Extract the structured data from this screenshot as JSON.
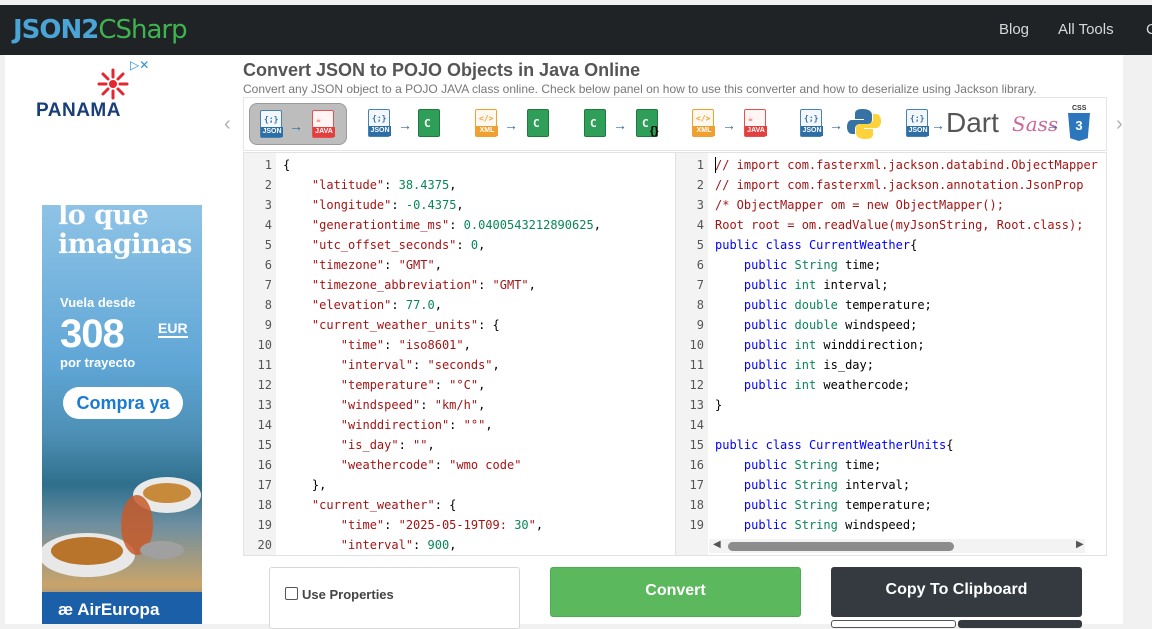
{
  "nav": {
    "logo_part1": "JSON2",
    "logo_part2": "CSharp",
    "links": [
      "Blog",
      "All Tools",
      "C"
    ]
  },
  "ad": {
    "brand": "PANAMA",
    "headline": "Más de lo que imaginas",
    "vuela": "Vuela desde",
    "price": "308",
    "currency": "EUR",
    "per": "por trayecto",
    "cta": "Compra ya",
    "airline": "AirEuropa",
    "choices_icon": "ad-choices-icon"
  },
  "page": {
    "title": "Convert JSON to POJO Objects in Java Online",
    "subtitle": "Convert any JSON object to a POJO JAVA class online. Check below panel on how to use this converter and how to deserialize using Jackson library."
  },
  "converters": [
    {
      "name": "json-to-java",
      "from": "JSON",
      "to": "JAVA",
      "active": true
    },
    {
      "name": "json-to-csharp",
      "from": "JSON",
      "to": "C#"
    },
    {
      "name": "xml-to-csharp",
      "from": "XML",
      "to": "C#"
    },
    {
      "name": "csharp-to-json",
      "from": "C#",
      "to": "C# {}"
    },
    {
      "name": "xml-to-java",
      "from": "XML",
      "to": "JAVA"
    },
    {
      "name": "json-to-python",
      "from": "JSON",
      "to": "Python"
    },
    {
      "name": "json-to-dart",
      "from": "JSON",
      "to": "Dart"
    },
    {
      "name": "sass-to-css",
      "from": "Sass",
      "to": "CSS"
    }
  ],
  "converter_labels": {
    "json": "JSON",
    "java": "JAVA",
    "xml": "XML",
    "dart": "Dart",
    "sass": "Sass",
    "css": "CSS"
  },
  "input_lines": [
    "{",
    "    \"latitude\": 38.4375,",
    "    \"longitude\": -0.4375,",
    "    \"generationtime_ms\": 0.0400543212890625,",
    "    \"utc_offset_seconds\": 0,",
    "    \"timezone\": \"GMT\",",
    "    \"timezone_abbreviation\": \"GMT\",",
    "    \"elevation\": 77.0,",
    "    \"current_weather_units\": {",
    "        \"time\": \"iso8601\",",
    "        \"interval\": \"seconds\",",
    "        \"temperature\": \"°C\",",
    "        \"windspeed\": \"km/h\",",
    "        \"winddirection\": \"°\",",
    "        \"is_day\": \"\",",
    "        \"weathercode\": \"wmo code\"",
    "    },",
    "    \"current_weather\": {",
    "        \"time\": \"2025-05-19T09:30\",",
    "        \"interval\": 900,"
  ],
  "output_lines": [
    "// import com.fasterxml.jackson.databind.ObjectMapper",
    "// import com.fasterxml.jackson.annotation.JsonProp",
    "/* ObjectMapper om = new ObjectMapper();",
    "Root root = om.readValue(myJsonString, Root.class);",
    "public class CurrentWeather{",
    "    public String time;",
    "    public int interval;",
    "    public double temperature;",
    "    public double windspeed;",
    "    public int winddirection;",
    "    public int is_day;",
    "    public int weathercode;",
    "}",
    "",
    "public class CurrentWeatherUnits{",
    "    public String time;",
    "    public String interval;",
    "    public String temperature;",
    "    public String windspeed;",
    ""
  ],
  "controls": {
    "use_properties_label": "Use Properties",
    "use_properties_checked": false,
    "convert_label": "Convert",
    "copy_label": "Copy To Clipboard"
  },
  "colors": {
    "nav_bg": "#1f2326",
    "convert_green": "#5cb85c",
    "copy_dark": "#343a40",
    "logo_blue": "#4aa5d6",
    "logo_green": "#3fb34f"
  }
}
